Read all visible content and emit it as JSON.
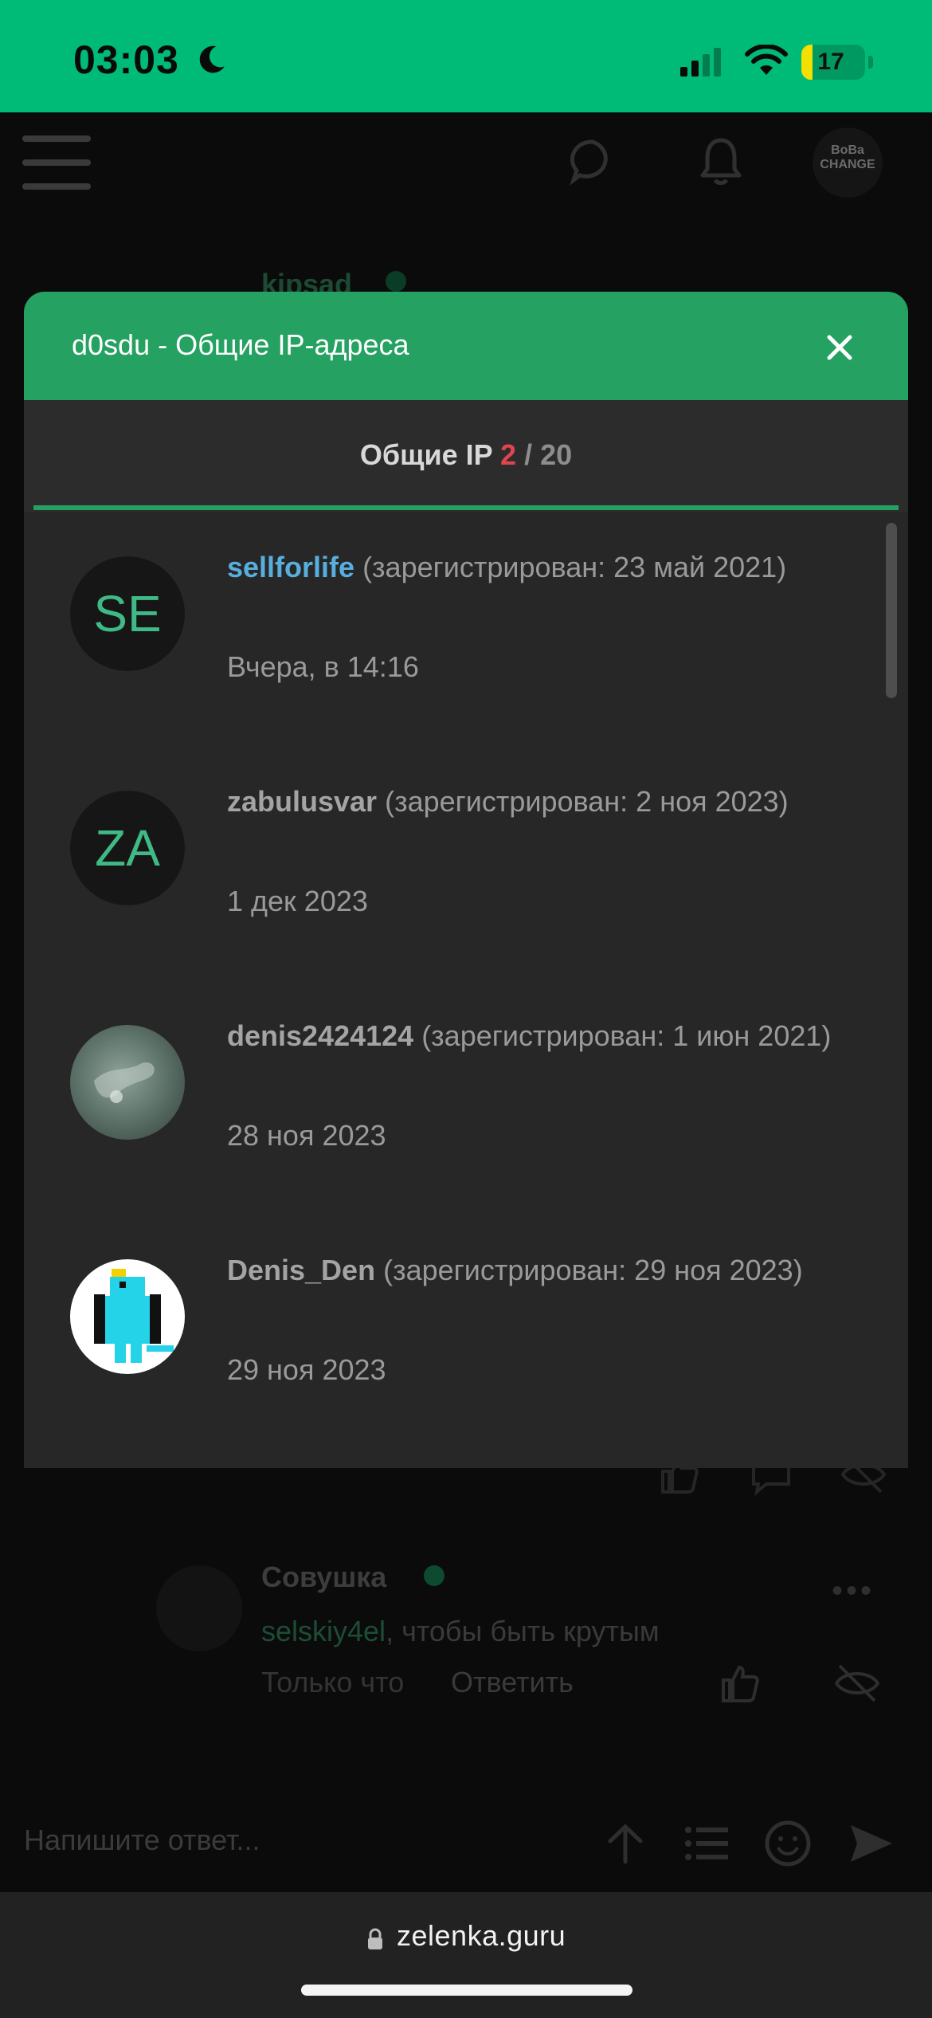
{
  "status_bar": {
    "time": "03:03",
    "battery": "17",
    "battery_level": 0.17,
    "colors": {
      "background": "#00bb77"
    }
  },
  "header": {
    "avatar_text": "BoBa CHANGE",
    "icons": [
      "menu-icon",
      "chat-icon",
      "bell-icon"
    ]
  },
  "background": {
    "top_author": "kipsad",
    "comment": {
      "author": "Совушка",
      "mention": "selskiy4el",
      "text": ", чтобы быть крутым",
      "time": "Только что",
      "reply": "Ответить"
    },
    "reply_placeholder": "Напишите ответ...",
    "url": "zelenka.guru"
  },
  "modal": {
    "title": "d0sdu - Общие IP-адреса",
    "tab": {
      "label": "Общие IP",
      "current": "2",
      "separator": "/",
      "total": "20"
    },
    "accent_color": "#25a162",
    "users": [
      {
        "initials": "SE",
        "name": "sellforlife",
        "registered": " (зарегистрирован: 23 май 2021)",
        "date": "Вчера, в 14:16",
        "highlighted": true
      },
      {
        "initials": "ZA",
        "name": "zabulusvar",
        "registered": " (зарегистрирован: 2 ноя 2023)",
        "date": "1 дек 2023",
        "highlighted": false
      },
      {
        "initials": "",
        "name": "denis2424124",
        "registered": " (зарегистрирован: 1 июн 2021)",
        "date": "28 ноя 2023",
        "highlighted": false
      },
      {
        "initials": "",
        "name": "Denis_Den",
        "registered": " (зарегистрирован: 29 ноя 2023)",
        "date": "29 ноя 2023",
        "highlighted": false
      }
    ]
  }
}
